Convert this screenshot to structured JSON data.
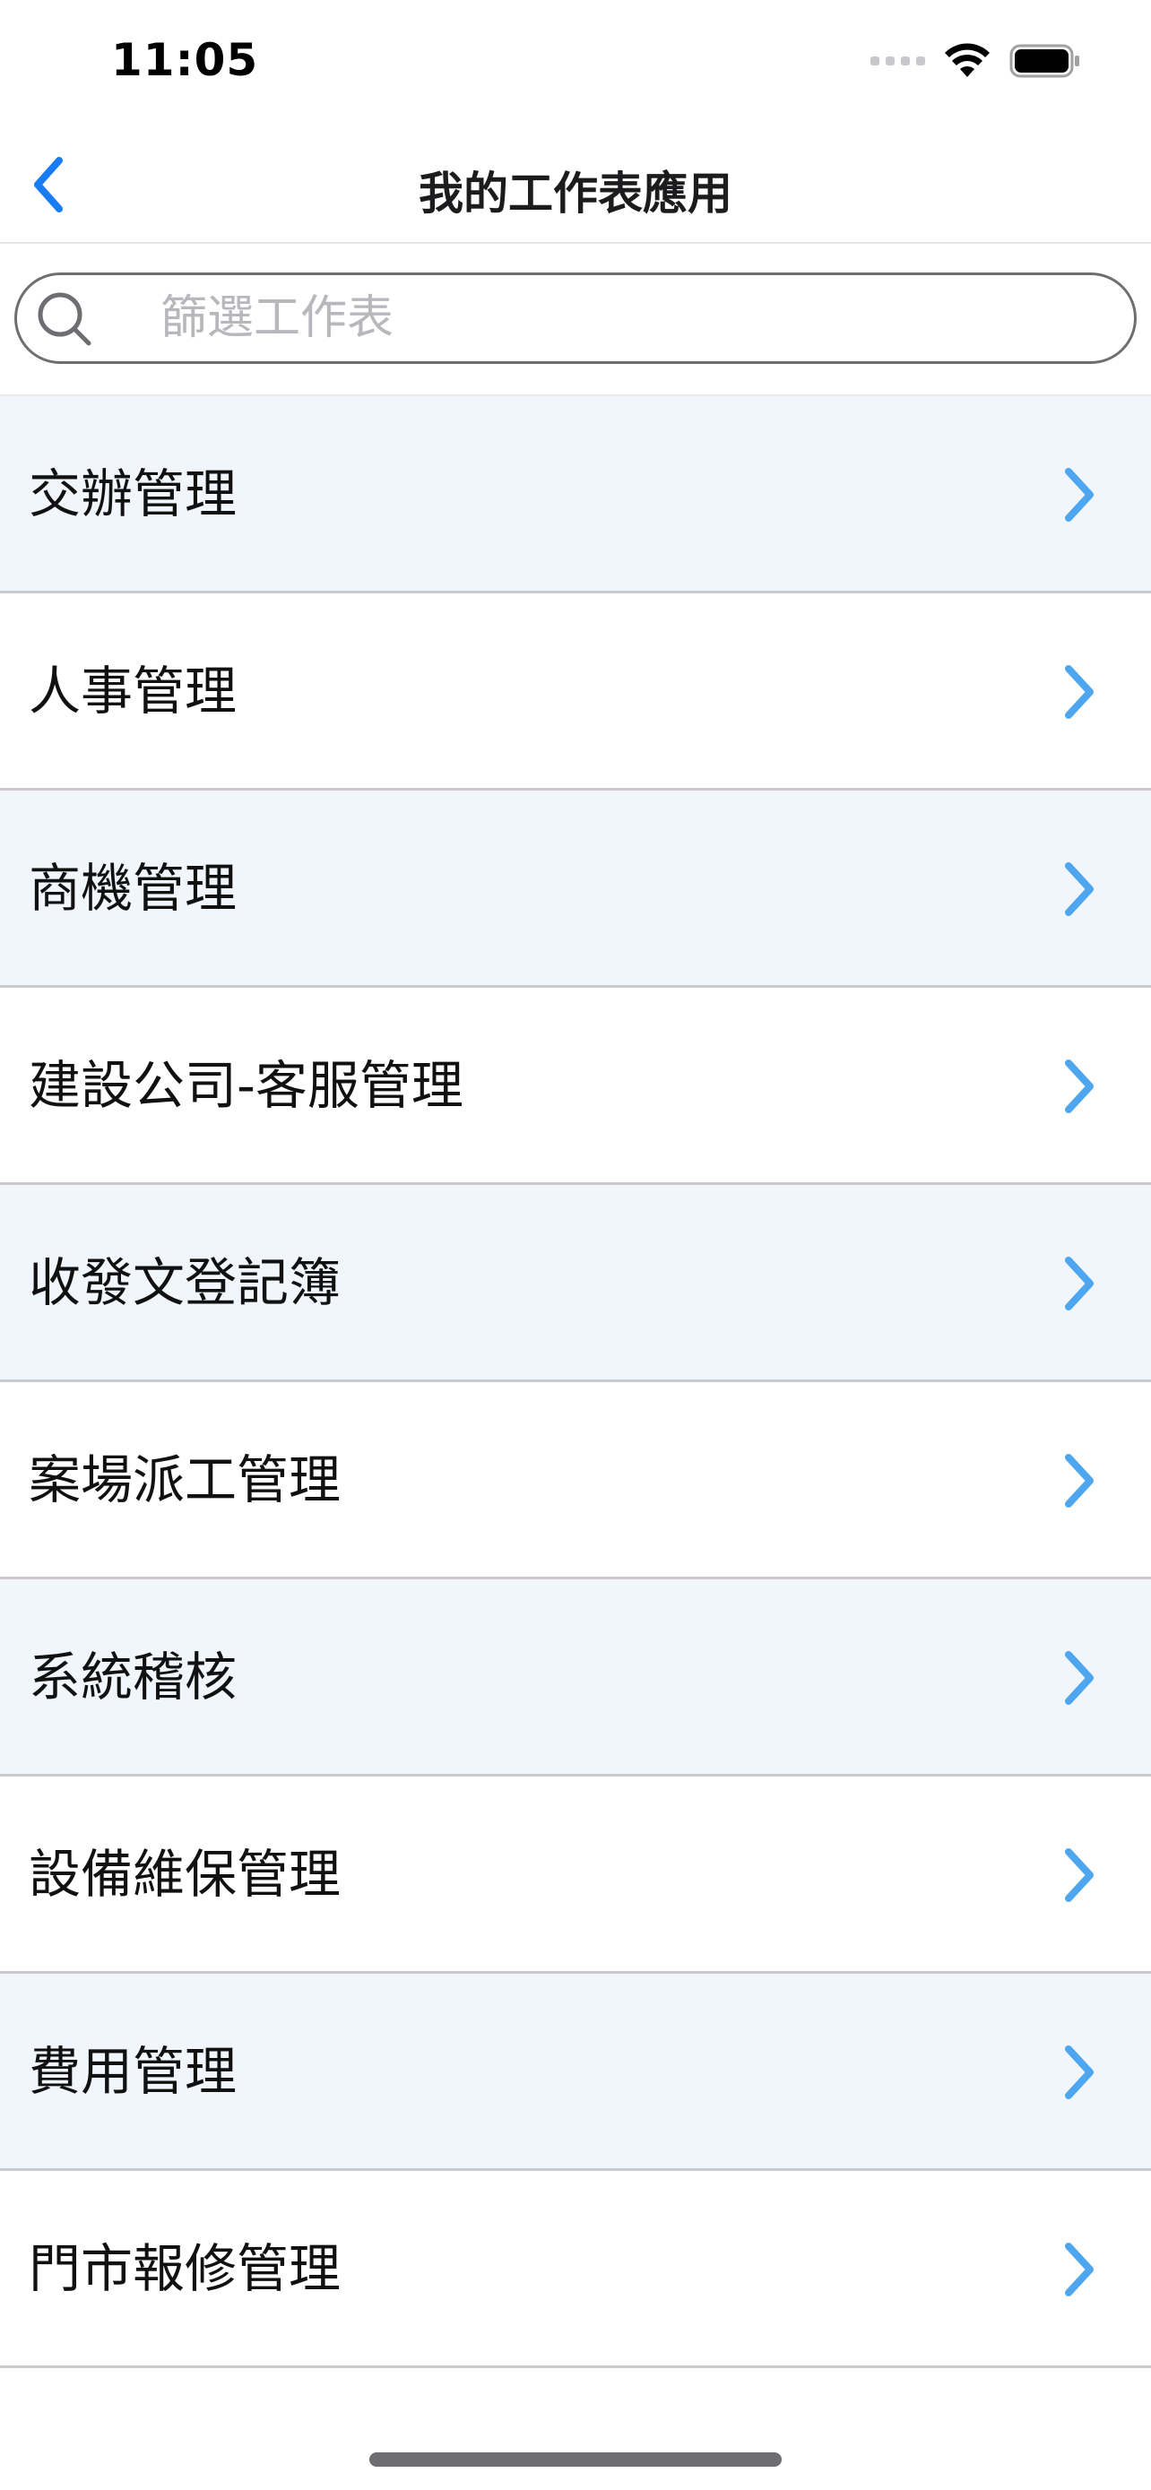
{
  "status_bar": {
    "time": "11:05"
  },
  "nav": {
    "title": "我的工作表應用",
    "back_icon": "chevron-left-icon"
  },
  "search": {
    "placeholder": "篩選工作表",
    "value": ""
  },
  "list": {
    "items": [
      {
        "label": "交辦管理"
      },
      {
        "label": "人事管理"
      },
      {
        "label": "商機管理"
      },
      {
        "label": "建設公司-客服管理"
      },
      {
        "label": "收發文登記簿"
      },
      {
        "label": "案場派工管理"
      },
      {
        "label": "系統稽核"
      },
      {
        "label": "設備維保管理"
      },
      {
        "label": "費用管理"
      },
      {
        "label": "門市報修管理"
      }
    ]
  },
  "colors": {
    "accent": "#1a7cf5",
    "chevron": "#4ea7ee",
    "alt_row": "#f1f6fd",
    "divider": "#c9c9cd"
  }
}
